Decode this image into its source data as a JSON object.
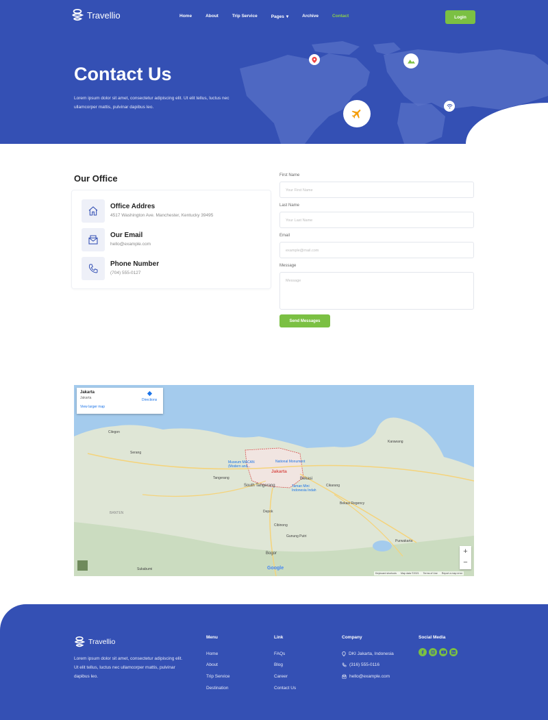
{
  "brand": {
    "name": "Travellio"
  },
  "nav": {
    "items": [
      "Home",
      "About",
      "Trip Service",
      "Pages",
      "Archive",
      "Contact"
    ],
    "pages_caret": "▾",
    "login": "Login"
  },
  "hero": {
    "title": "Contact Us",
    "text": "Lorem ipsum dolor sit amet, consectetur adipiscing elit. Ut elit tellus, luctus nec ullamcorper mattis, pulvinar dapibus leo."
  },
  "office": {
    "title": "Our Office",
    "items": [
      {
        "icon": "home-icon",
        "title": "Office Addres",
        "text": "4517 Washington Ave. Manchester, Kentucky 39495"
      },
      {
        "icon": "mail-icon",
        "title": "Our Email",
        "text": "hello@example.com"
      },
      {
        "icon": "phone-icon",
        "title": "Phone Number",
        "text": "(704) 555-0127"
      }
    ]
  },
  "form": {
    "first_label": "First Name",
    "first_placeholder": "Your First Name",
    "last_label": "Last Name",
    "last_placeholder": "Your Last Name",
    "email_label": "Email",
    "email_placeholder": "example@mail.com",
    "message_label": "Message",
    "message_placeholder": "Message",
    "submit": "Send Messages"
  },
  "map": {
    "card_title": "Jakarta",
    "card_sub": "Jakarta",
    "directions": "Directions",
    "larger": "View larger map",
    "labels": [
      "Cilegon",
      "Serang",
      "Tangerang",
      "South Tangerang",
      "Jakarta",
      "Bekasi",
      "Bekasi Regency",
      "Depok",
      "Bogor",
      "Purwakarta",
      "Karawang",
      "Cikarang",
      "National Monument",
      "Museum MACAN (Modern and...",
      "Taman Mini Indonesia Indah",
      "BANTEN",
      "Gunung Putri",
      "Cibinong",
      "Sukabumi"
    ],
    "footer_text": [
      "Keyboard shortcuts",
      "Map data ©2021",
      "Terms of Use",
      "Report a map error"
    ],
    "zoom_in": "+",
    "zoom_out": "−"
  },
  "footer": {
    "brand": "Travellio",
    "text": "Lorem ipsum dolor sit amet, consectetur adipiscing elit. Ut elit tellus, luctus nec ullamcorper mattis, pulvinar dapibus leo.",
    "menu": {
      "title": "Menu",
      "items": [
        "Home",
        "About",
        "Trip Service",
        "Destination"
      ]
    },
    "link": {
      "title": "Link",
      "items": [
        "FAQs",
        "Blog",
        "Career",
        "Contact Us"
      ]
    },
    "company": {
      "title": "Company",
      "items": [
        {
          "icon": "location-icon",
          "text": "DKI Jakarta, Indonesia"
        },
        {
          "icon": "phone-icon",
          "text": "(316) 555-0116"
        },
        {
          "icon": "mail-icon",
          "text": "hello@example.com"
        }
      ]
    },
    "social": {
      "title": "Social Media",
      "icons": [
        "facebook-icon",
        "instagram-icon",
        "youtube-icon",
        "linkedin-icon"
      ]
    }
  },
  "colors": {
    "primary": "#3450b4",
    "accent": "#7bc043"
  }
}
